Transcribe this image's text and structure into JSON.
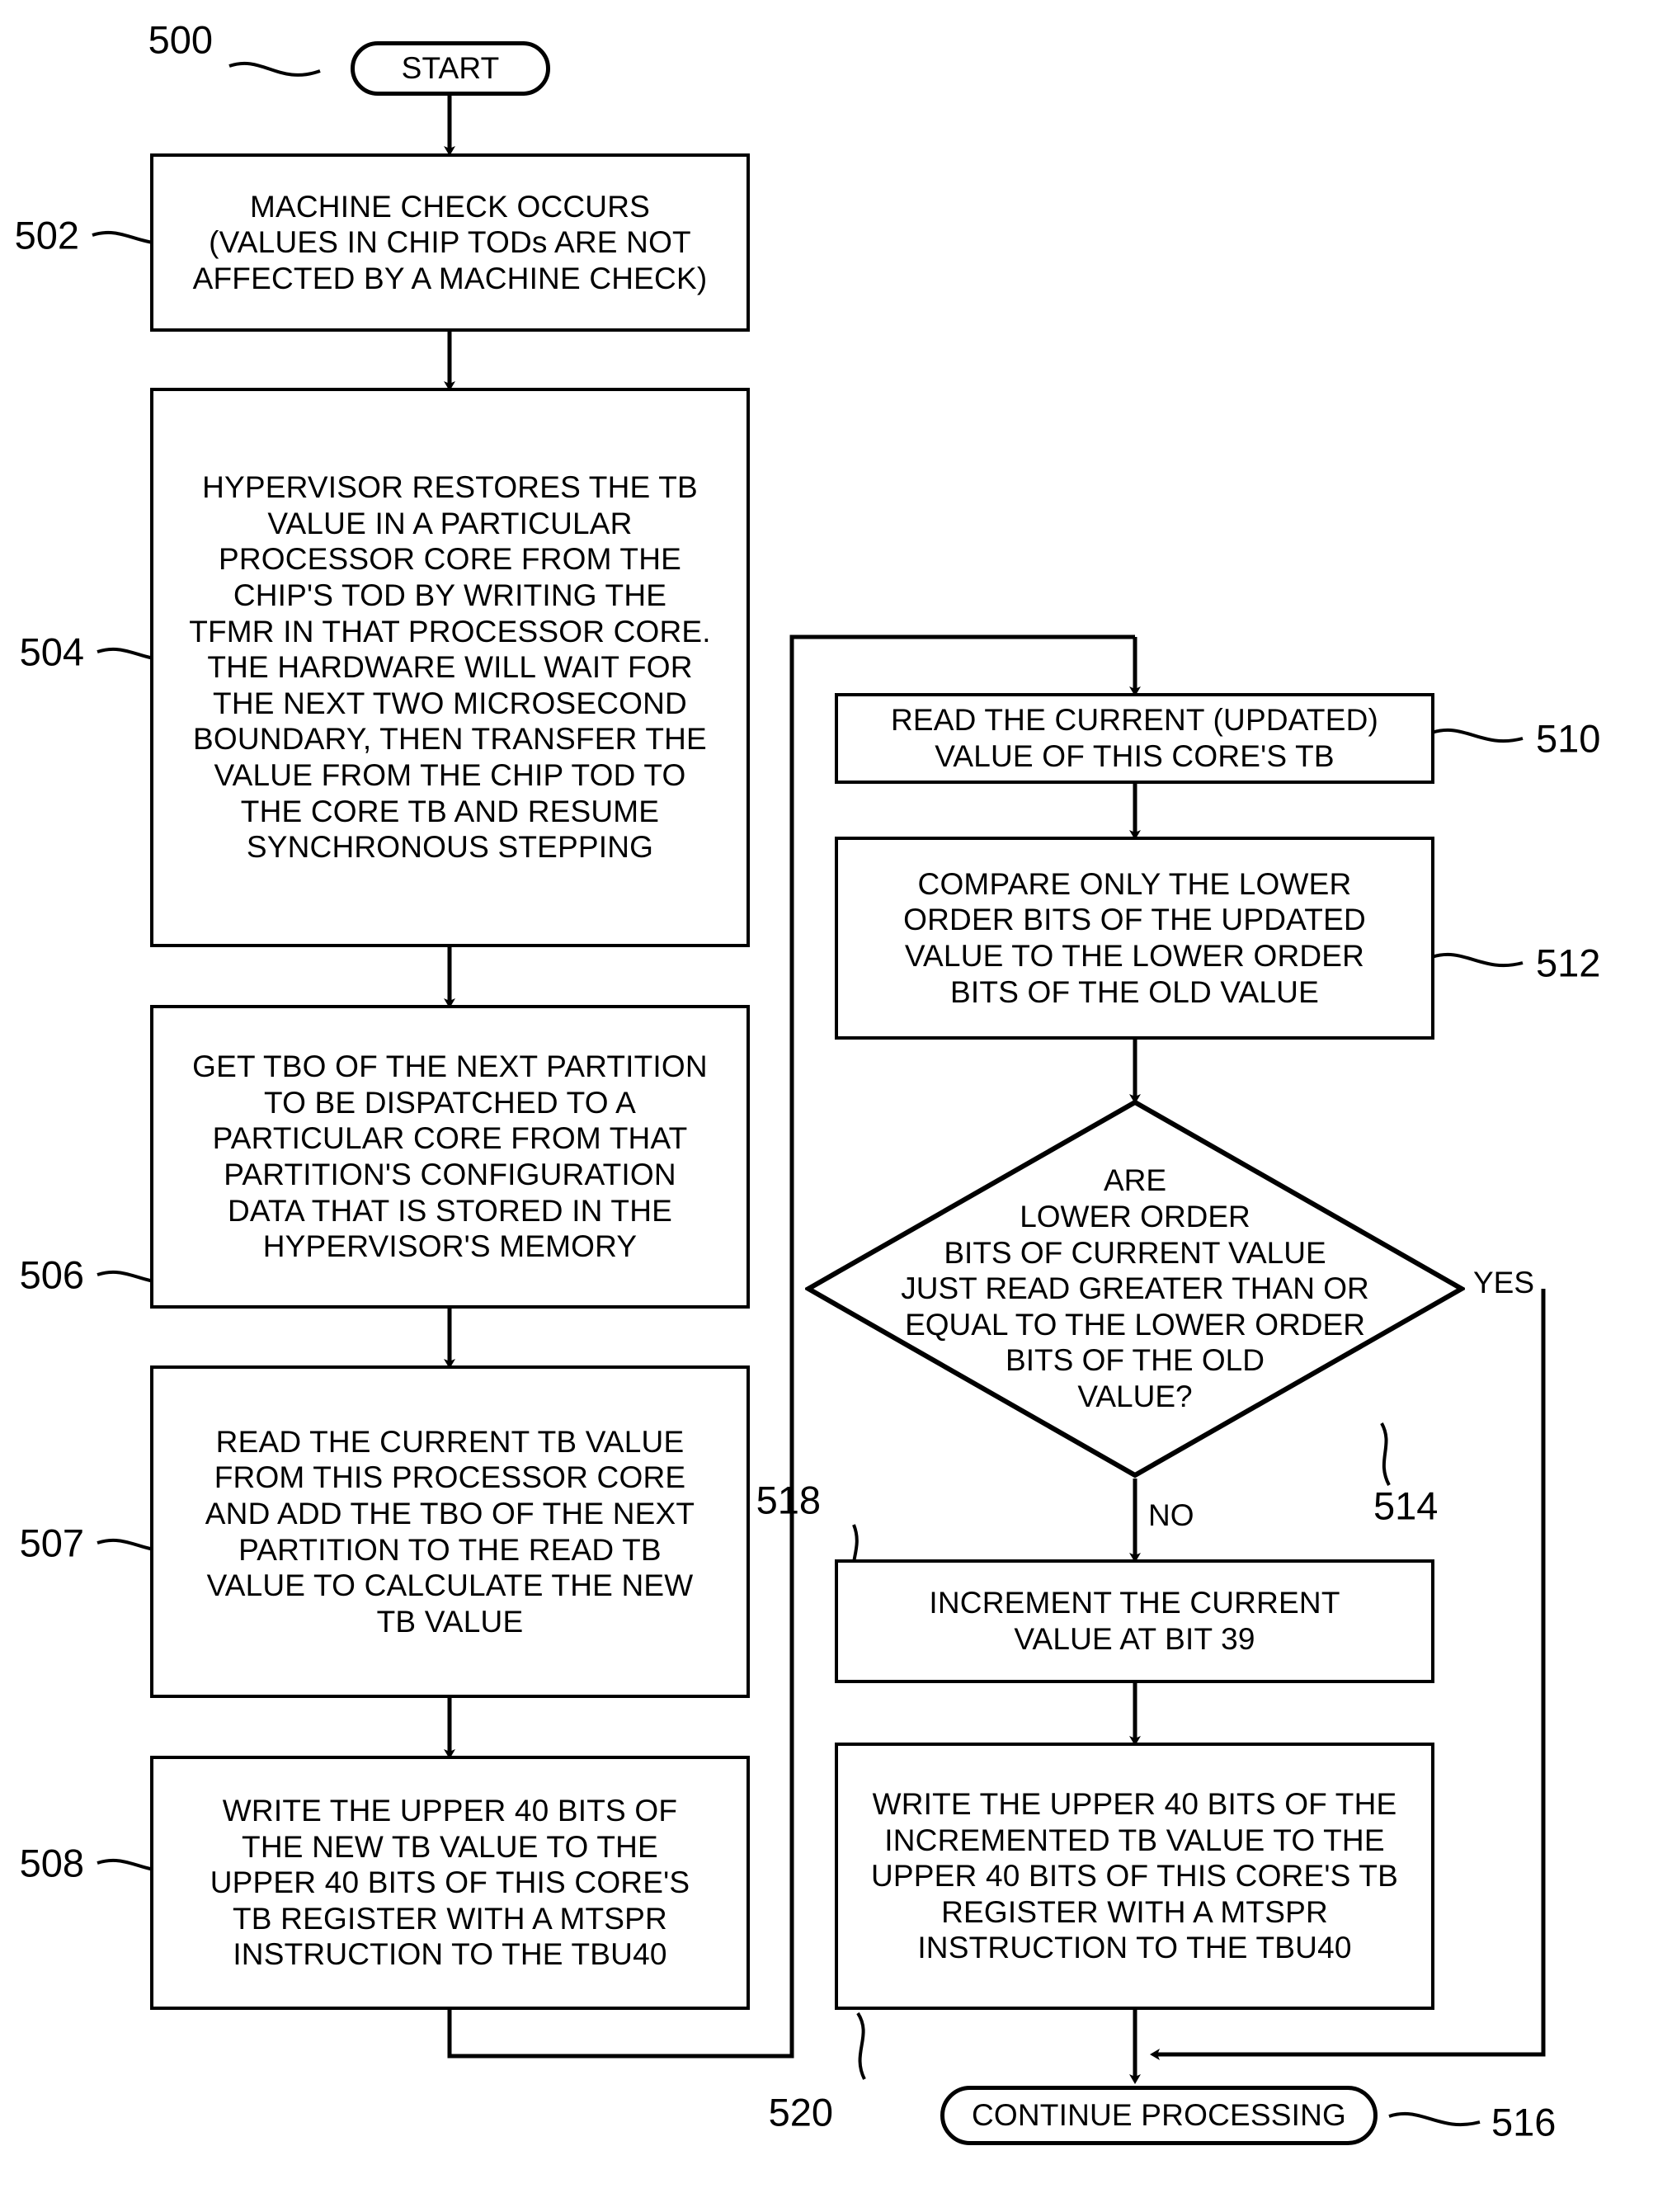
{
  "figure": {
    "title": "Time base restore flowchart",
    "line_color": "#000000",
    "background": "#ffffff"
  },
  "nodes": {
    "start": {
      "ref": "500",
      "label": "START",
      "shape": "terminal"
    },
    "machine_check": {
      "ref": "502",
      "label": "MACHINE CHECK OCCURS\n(VALUES IN CHIP TODs ARE NOT\nAFFECTED BY A MACHINE CHECK)",
      "shape": "process"
    },
    "hypervisor_restores": {
      "ref": "504",
      "label": "HYPERVISOR RESTORES THE TB\nVALUE IN A PARTICULAR\nPROCESSOR CORE FROM THE\nCHIP'S TOD BY WRITING THE\nTFMR IN THAT PROCESSOR CORE.\nTHE HARDWARE WILL WAIT FOR\nTHE NEXT TWO MICROSECOND\nBOUNDARY, THEN TRANSFER THE\nVALUE FROM THE CHIP TOD TO\nTHE CORE TB AND RESUME\nSYNCHRONOUS STEPPING",
      "shape": "process"
    },
    "get_tbo": {
      "ref": "506",
      "label": "GET TBO OF THE NEXT PARTITION\nTO BE DISPATCHED TO A\nPARTICULAR CORE FROM THAT\nPARTITION'S CONFIGURATION\nDATA THAT IS STORED IN THE\nHYPERVISOR'S MEMORY",
      "shape": "process"
    },
    "read_current_tb": {
      "ref": "507",
      "label": "READ THE CURRENT TB VALUE\nFROM THIS PROCESSOR CORE\nAND ADD THE TBO OF THE NEXT\nPARTITION TO THE READ TB\nVALUE TO CALCULATE THE NEW\nTB VALUE",
      "shape": "process"
    },
    "write_new_tb": {
      "ref": "508",
      "label": "WRITE THE UPPER 40 BITS OF\nTHE NEW TB VALUE TO THE\nUPPER 40 BITS OF THIS CORE'S\nTB REGISTER WITH A MTSPR\nINSTRUCTION TO THE TBU40",
      "shape": "process"
    },
    "read_updated": {
      "ref": "510",
      "label": "READ THE CURRENT (UPDATED)\nVALUE OF THIS CORE'S TB",
      "shape": "process"
    },
    "compare_lower": {
      "ref": "512",
      "label": "COMPARE ONLY THE LOWER\nORDER BITS OF THE UPDATED\nVALUE TO THE LOWER ORDER\nBITS OF THE OLD VALUE",
      "shape": "process"
    },
    "decision": {
      "ref": "514",
      "label": "ARE\nLOWER ORDER\nBITS OF CURRENT VALUE\nJUST READ GREATER THAN OR\nEQUAL TO THE LOWER ORDER\nBITS OF THE OLD\nVALUE?",
      "shape": "decision"
    },
    "increment": {
      "ref": "518",
      "label": "INCREMENT THE CURRENT\nVALUE AT BIT 39",
      "shape": "process"
    },
    "write_incremented": {
      "ref": "520",
      "label": "WRITE THE UPPER 40 BITS OF THE\nINCREMENTED TB VALUE TO THE\nUPPER 40 BITS OF THIS CORE'S TB\nREGISTER WITH A MTSPR\nINSTRUCTION TO THE TBU40",
      "shape": "process"
    },
    "continue": {
      "ref": "516",
      "label": "CONTINUE PROCESSING",
      "shape": "terminal"
    }
  },
  "branch_labels": {
    "yes": "YES",
    "no": "NO"
  }
}
